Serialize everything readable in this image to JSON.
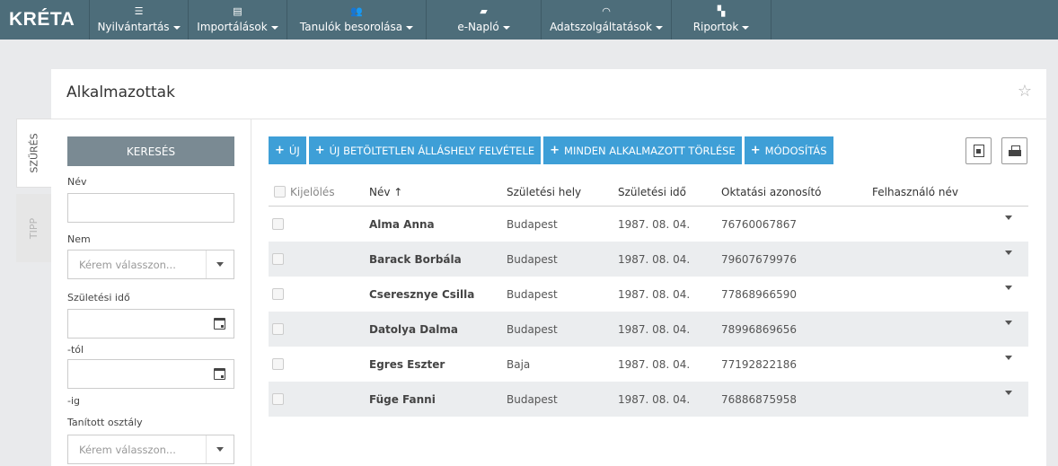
{
  "app": {
    "logo_text": "KRÉTA"
  },
  "nav": {
    "items": [
      {
        "label": "Nyilvántartás",
        "icon": "list-icon",
        "glyph": "☰"
      },
      {
        "label": "Importálások",
        "icon": "database-icon",
        "glyph": "▤"
      },
      {
        "label": "Tanulók besorolása",
        "icon": "users-icon",
        "glyph": "👥"
      },
      {
        "label": "e-Napló",
        "icon": "book-icon",
        "glyph": "▰"
      },
      {
        "label": "Adatszolgáltatások",
        "icon": "wifi-icon",
        "glyph": "◠"
      },
      {
        "label": "Riportok",
        "icon": "report-icon",
        "glyph": "▚"
      }
    ]
  },
  "page": {
    "title": "Alkalmazottak",
    "favorite_icon": "star-icon"
  },
  "side_tabs": {
    "filter": "SZŰRÉS",
    "tip": "TIPP"
  },
  "filter": {
    "search_button": "KERESÉS",
    "name_label": "Név",
    "gender_label": "Nem",
    "gender_placeholder": "Kérem válasszon...",
    "birth_label": "Születési idő",
    "from_label": "-tól",
    "to_label": "-ig",
    "class_label": "Tanított osztály",
    "class_placeholder": "Kérem válasszon..."
  },
  "toolbar": {
    "new": "ÚJ",
    "new_vacancy": "ÚJ BETÖLTETLEN ÁLLÁSHELY FELVÉTELE",
    "delete_all": "MINDEN ALKALMAZOTT TÖRLÉSE",
    "modify": "MÓDOSÍTÁS",
    "export_icon": "excel-export-icon",
    "print_icon": "print-icon"
  },
  "grid": {
    "columns": {
      "select": "Kijelölés",
      "name": "Név ↑",
      "birth_place": "Születési hely",
      "birth_date": "Születési idő",
      "edu_id": "Oktatási azonosító",
      "username": "Felhasználó név"
    },
    "rows": [
      {
        "name": "Alma Anna",
        "birth_place": "Budapest",
        "birth_date": "1987. 08. 04.",
        "edu_id": "76760067867",
        "username": ""
      },
      {
        "name": "Barack Borbála",
        "birth_place": "Budapest",
        "birth_date": "1987. 08. 04.",
        "edu_id": "79607679976",
        "username": ""
      },
      {
        "name": "Cseresznye Csilla",
        "birth_place": "Budapest",
        "birth_date": "1987. 08. 04.",
        "edu_id": "77868966590",
        "username": ""
      },
      {
        "name": "Datolya Dalma",
        "birth_place": "Budapest",
        "birth_date": "1987. 08. 04.",
        "edu_id": "78996869656",
        "username": ""
      },
      {
        "name": "Egres Eszter",
        "birth_place": "Baja",
        "birth_date": "1987. 08. 04.",
        "edu_id": "77192822186",
        "username": ""
      },
      {
        "name": "Füge Fanni",
        "birth_place": "Budapest",
        "birth_date": "1987. 08. 04.",
        "edu_id": "76886875958",
        "username": ""
      }
    ]
  },
  "colors": {
    "header": "#4d6d7a",
    "button": "#3e9fd7",
    "search": "#7a8a93",
    "row_alt": "#ebedef"
  }
}
